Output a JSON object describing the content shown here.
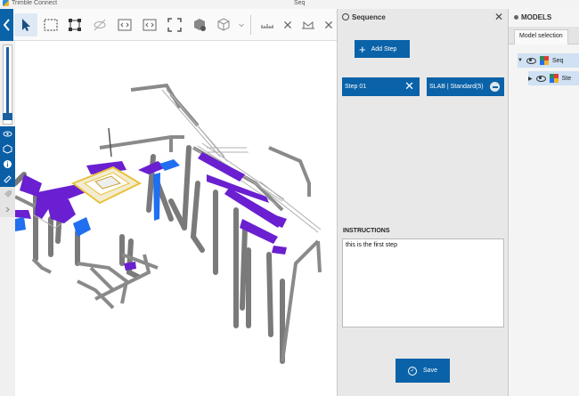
{
  "window": {
    "app_title": "Trimble Connect",
    "document_title": "Seq"
  },
  "toolbar": {
    "icons": [
      "collapse-left-icon",
      "select-pointer-icon",
      "box-select-icon",
      "fit-selection-icon",
      "hide-icon",
      "code-tag-icon",
      "code-tag-icon",
      "expand-icon",
      "models-icon",
      "cube-icon",
      "chevron-down-icon",
      "measure-icon",
      "close-icon",
      "measure-icon",
      "close-icon"
    ]
  },
  "sequence_panel": {
    "title": "Sequence",
    "add_step_label": "Add Step",
    "step": {
      "name": "Step 01",
      "tag": "SLAB | Standard(5)"
    },
    "instructions_label": "INSTRUCTIONS",
    "instructions_text": "this is the first step",
    "save_label": "Save"
  },
  "models_panel": {
    "title": "MODELS",
    "tab_label": "Model selection",
    "tree": [
      {
        "label": "Seq",
        "expanded": true
      },
      {
        "label": "Ste",
        "expanded": false
      }
    ]
  },
  "colors": {
    "accent": "#0a62a8",
    "slab_purple": "#6a1fd0",
    "highlight_yellow": "#e8c23c"
  }
}
